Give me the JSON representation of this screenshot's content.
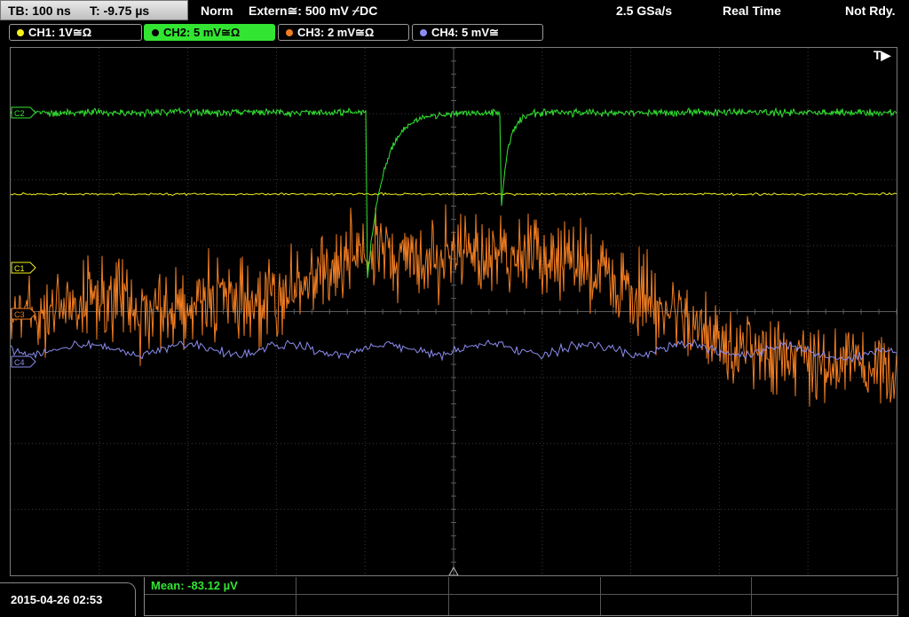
{
  "header": {
    "timebase": "TB: 100 ns",
    "trigger_time": "T: -9.75 µs",
    "mode": "Norm",
    "trigger_source": "Extern≅: 500 mV ⌿DC",
    "sample_rate": "2.5 GSa/s",
    "acq_mode": "Real Time",
    "status": "Not Rdy."
  },
  "channels": [
    {
      "label": "CH1: 1V≅Ω",
      "color": "#f2f21a",
      "active": false
    },
    {
      "label": "CH2: 5 mV≅Ω",
      "color": "#33e533",
      "active": true
    },
    {
      "label": "CH3: 2 mV≅Ω",
      "color": "#f07d22",
      "active": false
    },
    {
      "label": "CH4: 5 mV≅",
      "color": "#8c8cf0",
      "active": false
    }
  ],
  "markers": {
    "trigger": "T▶",
    "c1": "C1",
    "c2": "C2",
    "c3": "C3",
    "c4": "C4"
  },
  "footer": {
    "datetime": "2015-04-26 02:53",
    "measurement": "Mean: -83.12 µV"
  },
  "colors": {
    "ch1": "#f2f21a",
    "ch2": "#33e533",
    "ch3": "#f07d22",
    "ch4": "#8c8cf0",
    "grid": "#3a3a3a",
    "grid_axis": "#5a5a5a"
  }
}
